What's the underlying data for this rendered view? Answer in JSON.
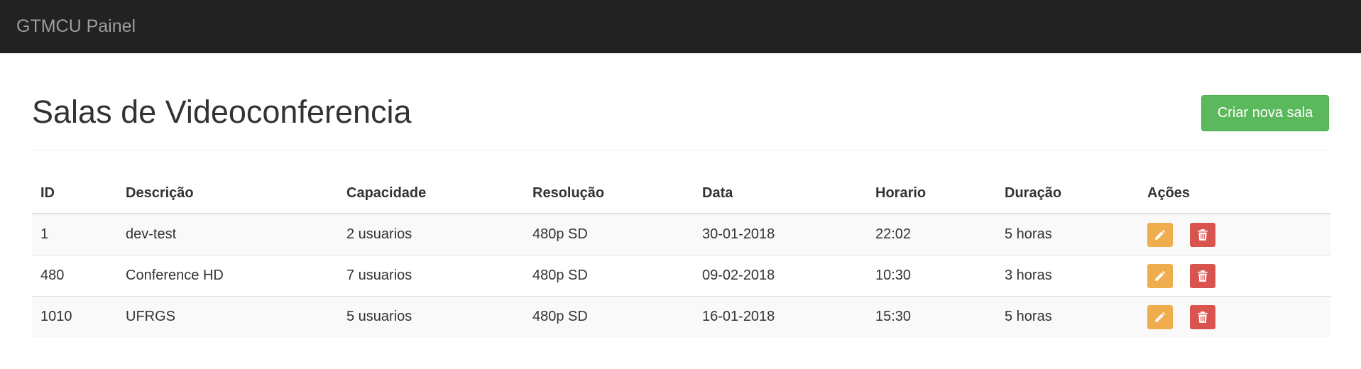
{
  "navbar": {
    "brand": "GTMCU Painel"
  },
  "page": {
    "title": "Salas de Videoconferencia",
    "create_button_label": "Criar nova sala"
  },
  "table": {
    "headers": [
      "ID",
      "Descrição",
      "Capacidade",
      "Resolução",
      "Data",
      "Horario",
      "Duração",
      "Ações"
    ],
    "rows": [
      {
        "id": "1",
        "description": "dev-test",
        "capacity": "2 usuarios",
        "resolution": "480p SD",
        "date": "30-01-2018",
        "time": "22:02",
        "duration": "5 horas"
      },
      {
        "id": "480",
        "description": "Conference HD",
        "capacity": "7 usuarios",
        "resolution": "480p SD",
        "date": "09-02-2018",
        "time": "10:30",
        "duration": "3 horas"
      },
      {
        "id": "1010",
        "description": "UFRGS",
        "capacity": "5 usuarios",
        "resolution": "480p SD",
        "date": "16-01-2018",
        "time": "15:30",
        "duration": "5 horas"
      }
    ],
    "row_actions": [
      {
        "icon": "pencil-icon",
        "color": "#f0ad4e"
      },
      {
        "icon": "trash-icon",
        "color": "#d9534f"
      }
    ]
  },
  "colors": {
    "navbar_bg": "#222222",
    "create_button": "#5cb85c",
    "edit_button": "#f0ad4e",
    "delete_button": "#d9534f"
  }
}
